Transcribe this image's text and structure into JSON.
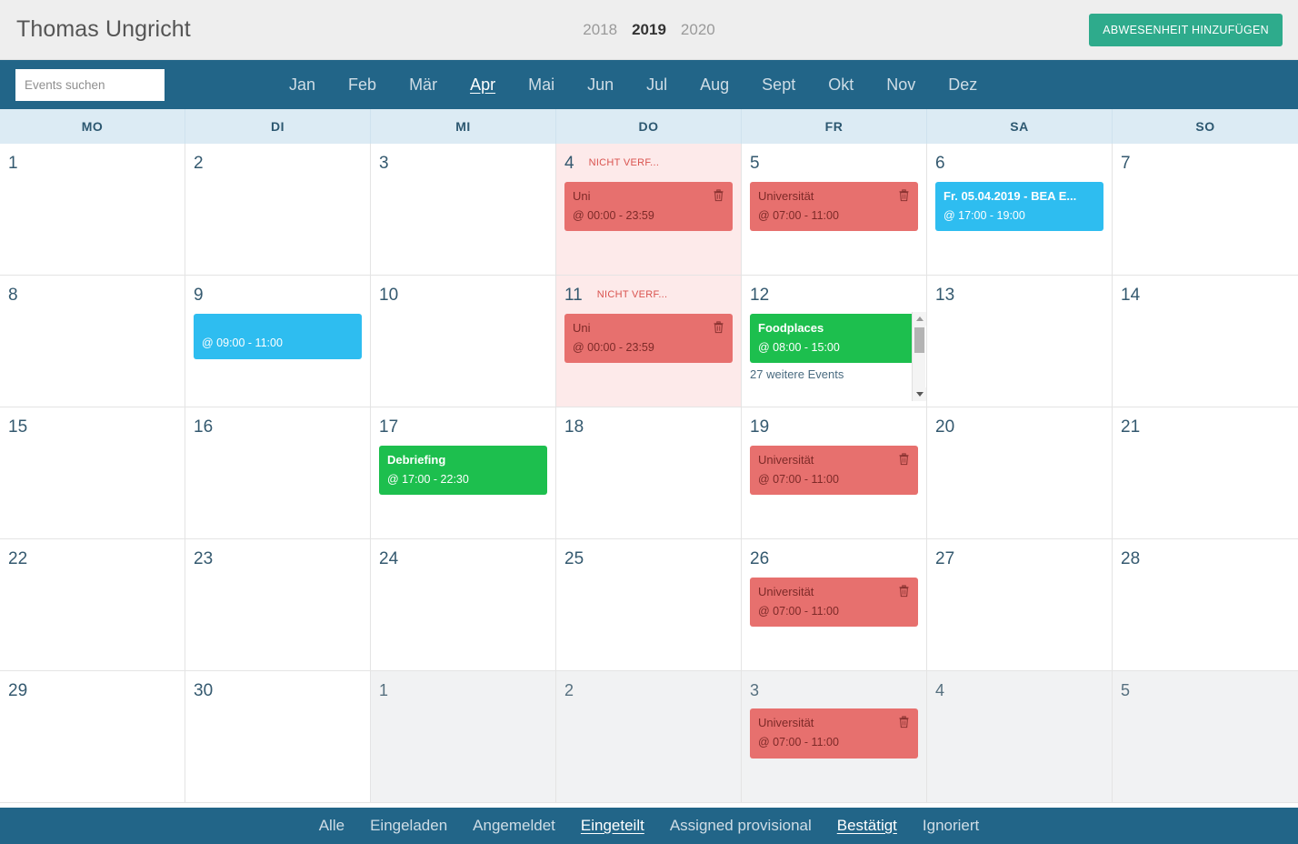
{
  "header": {
    "user_name": "Thomas Ungricht",
    "years": [
      {
        "label": "2018",
        "active": false
      },
      {
        "label": "2019",
        "active": true
      },
      {
        "label": "2020",
        "active": false
      }
    ],
    "add_absence_label": "ABWESENHEIT HINZUFÜGEN",
    "add_absence_color": "#2eab8c"
  },
  "search": {
    "placeholder": "Events suchen",
    "value": ""
  },
  "months": [
    {
      "label": "Jan",
      "active": false
    },
    {
      "label": "Feb",
      "active": false
    },
    {
      "label": "Mär",
      "active": false
    },
    {
      "label": "Apr",
      "active": true
    },
    {
      "label": "Mai",
      "active": false
    },
    {
      "label": "Jun",
      "active": false
    },
    {
      "label": "Jul",
      "active": false
    },
    {
      "label": "Aug",
      "active": false
    },
    {
      "label": "Sept",
      "active": false
    },
    {
      "label": "Okt",
      "active": false
    },
    {
      "label": "Nov",
      "active": false
    },
    {
      "label": "Dez",
      "active": false
    }
  ],
  "weekdays": [
    "MO",
    "DI",
    "MI",
    "DO",
    "FR",
    "SA",
    "SO"
  ],
  "labels": {
    "unavailable": "NICHT VERF...",
    "more_events": "27 weitere Events"
  },
  "colors": {
    "navbar": "#226588",
    "weekday_header": "#dcebf4",
    "event_red": "#e7706e",
    "event_blue": "#2ebdf0",
    "event_green": "#1dbf4e",
    "unavailable_cell": "#fdeaea",
    "othermonth_cell": "#f1f2f3",
    "unavailable_text": "#d9534f"
  },
  "days": [
    {
      "num": "1",
      "othermonth": false,
      "unavailable": false,
      "events": []
    },
    {
      "num": "2",
      "othermonth": false,
      "unavailable": false,
      "events": []
    },
    {
      "num": "3",
      "othermonth": false,
      "unavailable": false,
      "events": []
    },
    {
      "num": "4",
      "othermonth": false,
      "unavailable": true,
      "events": [
        {
          "title": "Uni",
          "time": "@ 00:00 - 23:59",
          "color": "red",
          "trash": true
        }
      ]
    },
    {
      "num": "5",
      "othermonth": false,
      "unavailable": false,
      "events": [
        {
          "title": "Universität",
          "time": "@ 07:00 - 11:00",
          "color": "red",
          "trash": true
        }
      ]
    },
    {
      "num": "6",
      "othermonth": false,
      "unavailable": false,
      "events": [
        {
          "title": "Fr. 05.04.2019 - BEA E...",
          "time": "@ 17:00 - 19:00",
          "color": "blue",
          "trash": false
        }
      ]
    },
    {
      "num": "7",
      "othermonth": false,
      "unavailable": false,
      "events": []
    },
    {
      "num": "8",
      "othermonth": false,
      "unavailable": false,
      "events": []
    },
    {
      "num": "9",
      "othermonth": false,
      "unavailable": false,
      "events": [
        {
          "title": "",
          "time": "@ 09:00 - 11:00",
          "color": "blue",
          "trash": false
        }
      ]
    },
    {
      "num": "10",
      "othermonth": false,
      "unavailable": false,
      "events": []
    },
    {
      "num": "11",
      "othermonth": false,
      "unavailable": true,
      "events": [
        {
          "title": "Uni",
          "time": "@ 00:00 - 23:59",
          "color": "red",
          "trash": true
        }
      ]
    },
    {
      "num": "12",
      "othermonth": false,
      "unavailable": false,
      "scrollable": true,
      "more": "27 weitere Events",
      "events": [
        {
          "title": "Foodplaces",
          "time": "@ 08:00 - 15:00",
          "color": "green",
          "trash": false
        }
      ]
    },
    {
      "num": "13",
      "othermonth": false,
      "unavailable": false,
      "events": []
    },
    {
      "num": "14",
      "othermonth": false,
      "unavailable": false,
      "events": []
    },
    {
      "num": "15",
      "othermonth": false,
      "unavailable": false,
      "events": []
    },
    {
      "num": "16",
      "othermonth": false,
      "unavailable": false,
      "events": []
    },
    {
      "num": "17",
      "othermonth": false,
      "unavailable": false,
      "events": [
        {
          "title": "Debriefing",
          "time": "@ 17:00 - 22:30",
          "color": "green",
          "trash": false
        }
      ]
    },
    {
      "num": "18",
      "othermonth": false,
      "unavailable": false,
      "events": []
    },
    {
      "num": "19",
      "othermonth": false,
      "unavailable": false,
      "events": [
        {
          "title": "Universität",
          "time": "@ 07:00 - 11:00",
          "color": "red",
          "trash": true
        }
      ]
    },
    {
      "num": "20",
      "othermonth": false,
      "unavailable": false,
      "events": []
    },
    {
      "num": "21",
      "othermonth": false,
      "unavailable": false,
      "events": []
    },
    {
      "num": "22",
      "othermonth": false,
      "unavailable": false,
      "events": []
    },
    {
      "num": "23",
      "othermonth": false,
      "unavailable": false,
      "events": []
    },
    {
      "num": "24",
      "othermonth": false,
      "unavailable": false,
      "events": []
    },
    {
      "num": "25",
      "othermonth": false,
      "unavailable": false,
      "events": []
    },
    {
      "num": "26",
      "othermonth": false,
      "unavailable": false,
      "events": [
        {
          "title": "Universität",
          "time": "@ 07:00 - 11:00",
          "color": "red",
          "trash": true
        }
      ]
    },
    {
      "num": "27",
      "othermonth": false,
      "unavailable": false,
      "events": []
    },
    {
      "num": "28",
      "othermonth": false,
      "unavailable": false,
      "events": []
    },
    {
      "num": "29",
      "othermonth": false,
      "unavailable": false,
      "events": []
    },
    {
      "num": "30",
      "othermonth": false,
      "unavailable": false,
      "events": []
    },
    {
      "num": "1",
      "othermonth": true,
      "unavailable": false,
      "events": []
    },
    {
      "num": "2",
      "othermonth": true,
      "unavailable": false,
      "events": []
    },
    {
      "num": "3",
      "othermonth": true,
      "unavailable": false,
      "events": [
        {
          "title": "Universität",
          "time": "@ 07:00 - 11:00",
          "color": "red",
          "trash": true
        }
      ]
    },
    {
      "num": "4",
      "othermonth": true,
      "unavailable": false,
      "events": []
    },
    {
      "num": "5",
      "othermonth": true,
      "unavailable": false,
      "events": []
    }
  ],
  "filters": [
    {
      "label": "Alle",
      "active": false
    },
    {
      "label": "Eingeladen",
      "active": false
    },
    {
      "label": "Angemeldet",
      "active": false
    },
    {
      "label": "Eingeteilt",
      "active": true
    },
    {
      "label": "Assigned provisional",
      "active": false
    },
    {
      "label": "Bestätigt",
      "active": true
    },
    {
      "label": "Ignoriert",
      "active": false
    }
  ]
}
